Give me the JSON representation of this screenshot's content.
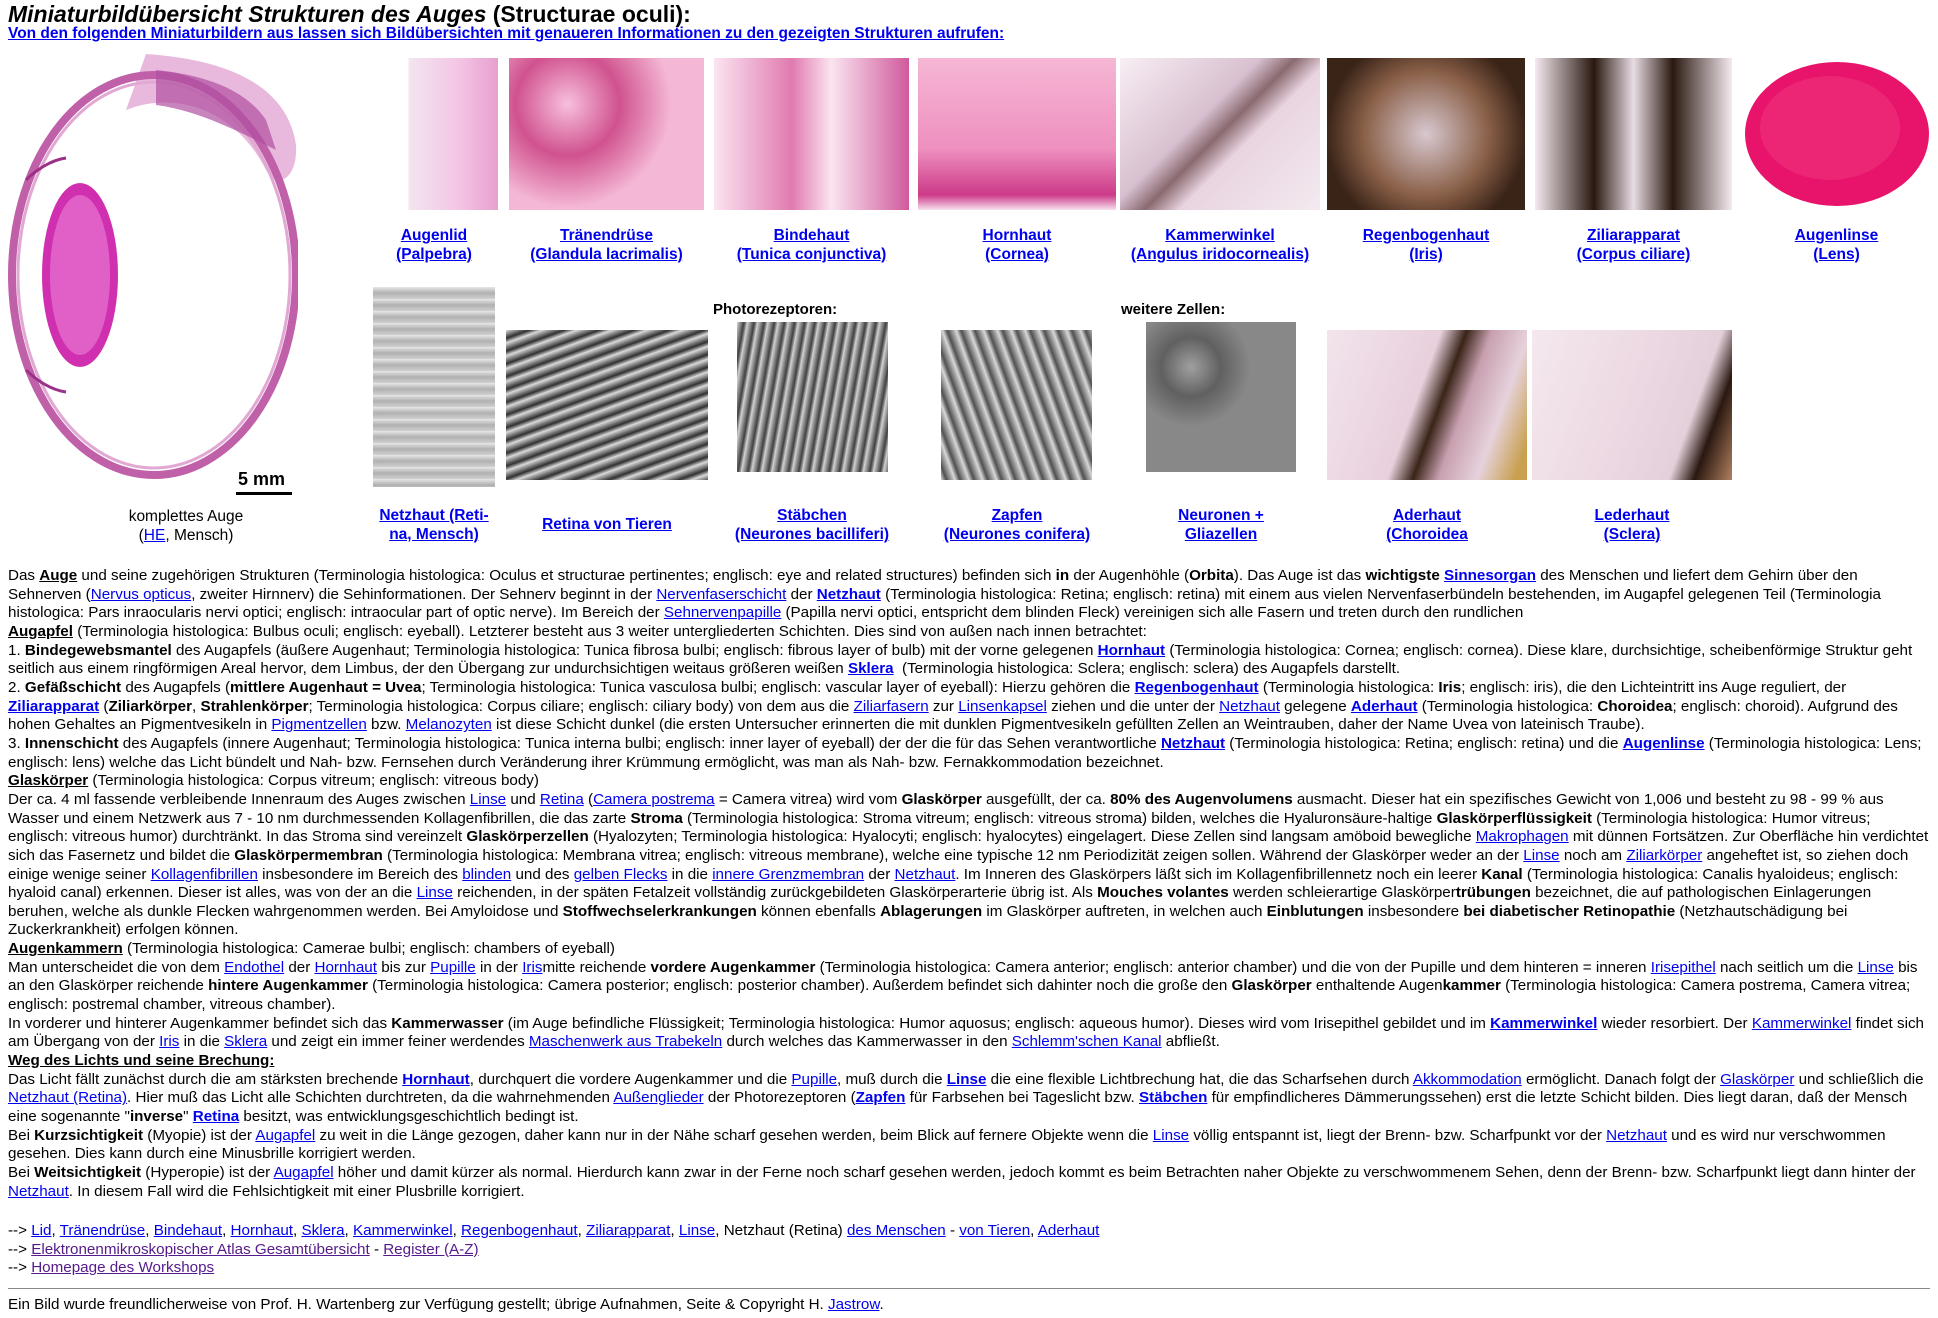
{
  "header": {
    "title_italic": "Miniaturbildübersicht Strukturen des Auges",
    "title_rest": " (Structurae oculi):",
    "subtitle": "Von den folgenden Miniaturbildern aus lassen sich Bildübersichten mit genaueren Informationen zu den gezeigten Strukturen aufrufen:"
  },
  "eye": {
    "scale_label": "5 mm",
    "caption_line1": "komplettes Auge",
    "caption_paren_open": "(",
    "caption_link": "HE",
    "caption_rest": ", Mensch)"
  },
  "row1": [
    {
      "l1": "Augenlid",
      "l2": "(Palpebra)"
    },
    {
      "l1": "Tränendrüse",
      "l2": "(Glandula lacrimalis)"
    },
    {
      "l1": "Bindehaut",
      "l2": "(Tunica conjunctiva)"
    },
    {
      "l1": "Hornhaut",
      "l2": "(Cornea)"
    },
    {
      "l1": "Kammerwinkel",
      "l2": "(Angulus iridocornealis)"
    },
    {
      "l1": "Regenbogenhaut",
      "l2": "(Iris)"
    },
    {
      "l1": "Ziliarapparat",
      "l2": "(Corpus ciliare)"
    },
    {
      "l1": "Augenlinse",
      "l2": "(Lens)"
    }
  ],
  "row2_headers": {
    "photo": "Photorezeptoren:",
    "more": "weitere Zellen:"
  },
  "row2": [
    {
      "l1": "Netzhaut (Reti-",
      "l2": "na, Mensch)"
    },
    {
      "l1": "Retina von Tieren",
      "l2": ""
    },
    {
      "l1": "Stäbchen",
      "l2": "(Neurones bacilliferi)"
    },
    {
      "l1": "Zapfen",
      "l2": "(Neurones conifera)"
    },
    {
      "l1": "Neuronen +",
      "l2": "Gliazellen"
    },
    {
      "l1": "Aderhaut",
      "l2": "(Choroidea"
    },
    {
      "l1": "Lederhaut",
      "l2": "(Sclera)"
    }
  ],
  "footer_nav": {
    "arrow": "-->",
    "line1_links": [
      "Lid",
      "Tränendrüse",
      "Bindehaut",
      "Hornhaut",
      "Sklera",
      "Kammerwinkel",
      "Regenbogenhaut",
      "Ziliarapparat",
      "Linse"
    ],
    "line1_plain": "Netzhaut (Retina)",
    "line1_link_humans": "des Menschen",
    "line1_link_animals": "von Tieren",
    "line1_last": "Aderhaut",
    "line2_a": "Elektronenmikroskopischer Atlas Gesamtübersicht",
    "line2_b": "Register (A-Z)",
    "line3": "Homepage des Workshops"
  },
  "credit": {
    "text": "Ein Bild wurde freundlicherweise von Prof. H. Wartenberg zur Verfügung gestellt; übrige Aufnahmen, Seite & Copyright H. ",
    "link": "Jastrow",
    "end": "."
  }
}
